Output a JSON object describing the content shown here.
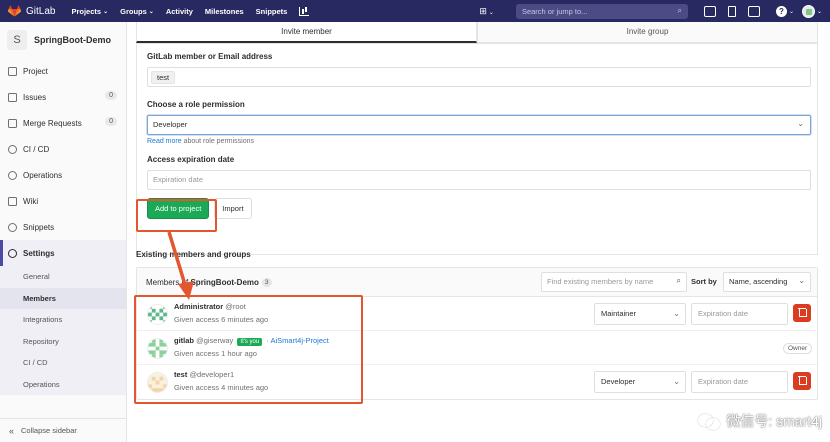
{
  "topnav": {
    "logo_text": "GitLab",
    "links": [
      {
        "label": "Projects",
        "has_caret": true
      },
      {
        "label": "Groups",
        "has_caret": true
      },
      {
        "label": "Activity",
        "has_caret": false
      },
      {
        "label": "Milestones",
        "has_caret": false
      },
      {
        "label": "Snippets",
        "has_caret": false
      }
    ],
    "search_placeholder": "Search or jump to...",
    "accent": "#292961"
  },
  "sidebar": {
    "project_initial": "S",
    "project_name": "SpringBoot-Demo",
    "items": [
      {
        "label": "Project",
        "icon": "home-icon"
      },
      {
        "label": "Issues",
        "icon": "issues-icon",
        "count": "0"
      },
      {
        "label": "Merge Requests",
        "icon": "merge-request-icon",
        "count": "0"
      },
      {
        "label": "CI / CD",
        "icon": "rocket-icon"
      },
      {
        "label": "Operations",
        "icon": "cloud-gear-icon"
      },
      {
        "label": "Wiki",
        "icon": "book-icon"
      },
      {
        "label": "Snippets",
        "icon": "scissors-icon"
      },
      {
        "label": "Settings",
        "icon": "gear-icon"
      }
    ],
    "settings_sub": [
      "General",
      "Members",
      "Integrations",
      "Repository",
      "CI / CD",
      "Operations"
    ],
    "collapse_label": "Collapse sidebar"
  },
  "tabs": [
    "Invite member",
    "Invite group"
  ],
  "form": {
    "member_label": "GitLab member or Email address",
    "member_token": "test",
    "role_label": "Choose a role permission",
    "role_value": "Developer",
    "read_more": "Read more",
    "read_more_suffix": " about role permissions",
    "expiration_label": "Access expiration date",
    "expiration_placeholder": "Expiration date",
    "add_button": "Add to project",
    "import_button": "Import"
  },
  "members": {
    "section_title": "Existing members and groups",
    "header_prefix": "Members of ",
    "header_project": "SpringBoot-Demo",
    "count": "3",
    "filter_placeholder": "Find existing members by name",
    "sort_label": "Sort by",
    "sort_value": "Name, ascending",
    "rows": [
      {
        "name": "Administrator",
        "username": "@root",
        "given": "Given access 6 minutes ago",
        "role": "Maintainer",
        "expiration_placeholder": "Expiration date"
      },
      {
        "name": "gitlab",
        "username": "@giserway",
        "its_you": "It's you",
        "via_sep": " · ",
        "via": "AiSmart4j-Project",
        "given": "Given access 1 hour ago",
        "badge": "Owner"
      },
      {
        "name": "test",
        "username": "@developer1",
        "given": "Given access 4 minutes ago",
        "role": "Developer",
        "expiration_placeholder": "Expiration date"
      }
    ]
  },
  "watermark": "微信号: smart4j",
  "colors": {
    "highlight": "#e2572f",
    "primary_green": "#1aaa55",
    "danger": "#db3b21",
    "link": "#1f78d1"
  }
}
